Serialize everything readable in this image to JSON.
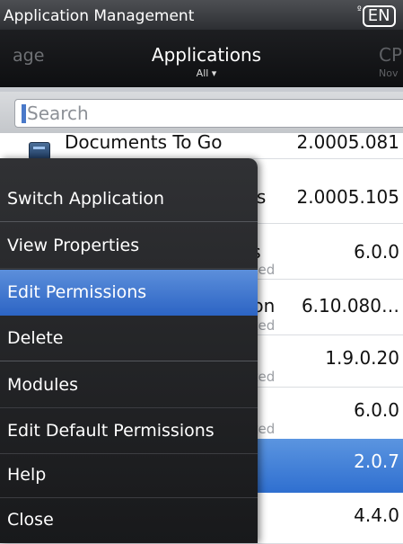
{
  "titlebar": {
    "title": "Application Management",
    "lang_sup": "º",
    "lang": "EN"
  },
  "header": {
    "left_tab": "age",
    "center_tab": {
      "label": "Applications",
      "filter": "All ▾"
    },
    "right_tab": {
      "label": "CP",
      "sub": "Nov"
    }
  },
  "search": {
    "placeholder": "Search"
  },
  "list": {
    "rows": [
      {
        "name": "Documents To Go",
        "version": "2.0005.081",
        "sub": ""
      },
      {
        "name": "les",
        "version": "2.0005.105",
        "sub": ""
      },
      {
        "name": "es",
        "version": "6.0.0",
        "sub": "nited"
      },
      {
        "name": "tion",
        "version": "6.10.080…",
        "sub": "nited"
      },
      {
        "name": "",
        "version": "1.9.0.20",
        "sub": "nited"
      },
      {
        "name": "",
        "version": "6.0.0",
        "sub": "nited"
      },
      {
        "name": "",
        "version": "2.0.7",
        "sub": ""
      },
      {
        "name": "",
        "version": "4.4.0",
        "sub": ""
      }
    ]
  },
  "menu": {
    "items": [
      {
        "label": "Switch Application"
      },
      {
        "label": "View Properties"
      },
      {
        "label": "Edit Permissions"
      },
      {
        "label": "Delete"
      },
      {
        "label": "Modules"
      },
      {
        "label": "Edit Default Permissions"
      },
      {
        "label": "Help"
      },
      {
        "label": "Close"
      }
    ],
    "highlighted_index": 2
  },
  "colors": {
    "highlight": "#3a74d2",
    "menu_bg": "#252629"
  }
}
